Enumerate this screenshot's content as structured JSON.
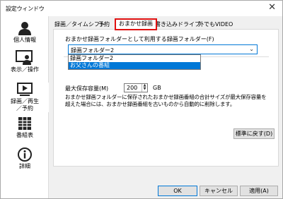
{
  "window": {
    "title": "設定ウィンドウ",
    "close_glyph": "✕"
  },
  "sidebar": {
    "items": [
      {
        "label": "個人情報",
        "icon": "person-icon"
      },
      {
        "label": "表示／操作",
        "icon": "person-screen-icon"
      },
      {
        "label": "録画／再生／予約",
        "icon": "play-screen-icon"
      },
      {
        "label": "番組表",
        "icon": "grid-icon"
      },
      {
        "label": "詳細",
        "icon": "info-icon"
      }
    ]
  },
  "tabs": [
    {
      "label": "録画／タイムシフト"
    },
    {
      "label": "予約"
    },
    {
      "label": "おまかせ録画"
    },
    {
      "label": "書き込みドライブ"
    },
    {
      "label": "外でもVIDEO"
    }
  ],
  "panel": {
    "folder_label": "おまかせ録画フォルダーとして利用する録画フォルダー(F)",
    "folder_value": "録画フォルダー2",
    "folder_options": [
      "録画フォルダー2",
      "お父さんの番組"
    ],
    "max_label": "最大保存容量(M)",
    "max_value": "200",
    "max_unit": "GB",
    "description": "おまかせ録画フォルダーに保存されたおまかせ録画番組の合計サイズが最大保存容量を超えた場合には、おまかせ録画番組を古いものから自動的に削除します。",
    "reset_label": "標準に戻す(D)"
  },
  "footer": {
    "ok_label": "OK",
    "cancel_label": "キャンセル",
    "apply_label": "適用(A)"
  }
}
